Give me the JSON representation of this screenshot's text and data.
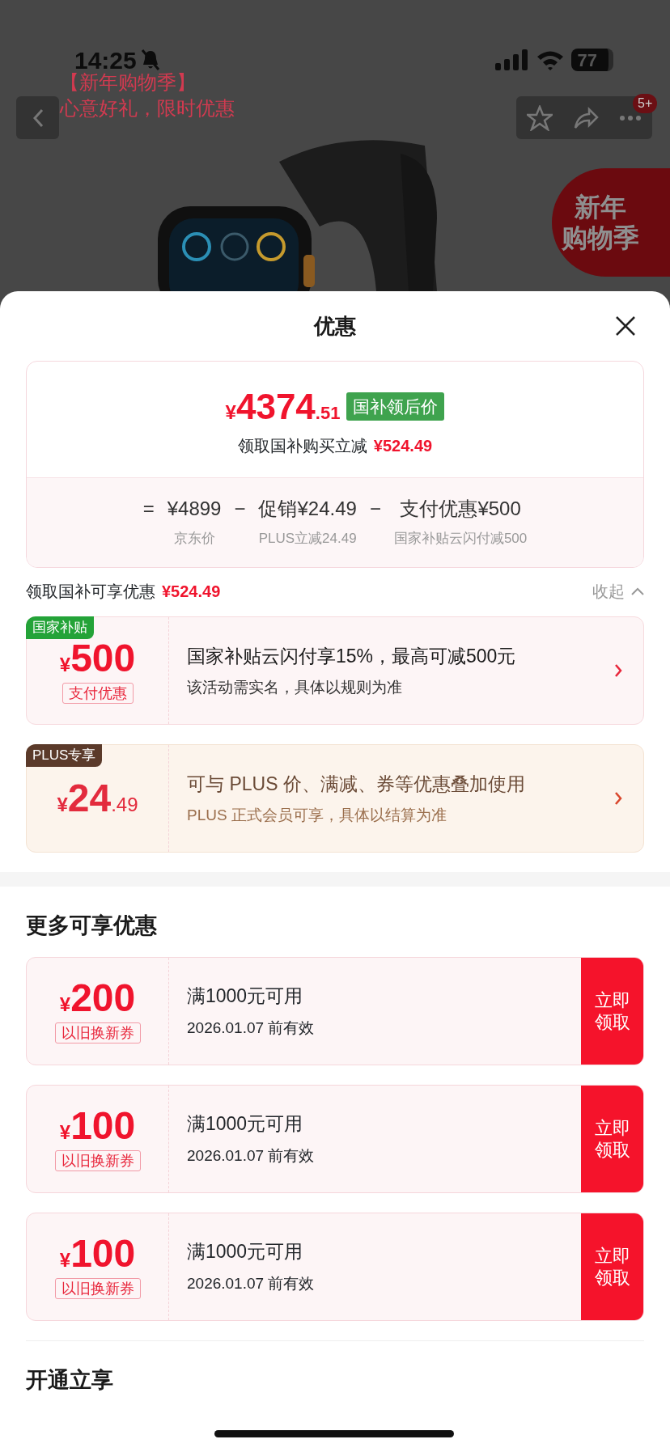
{
  "status_bar": {
    "time": "14:25",
    "battery": "77"
  },
  "background_page": {
    "promo_lines": [
      "【新年购物季】",
      "心意好礼，限时优惠"
    ],
    "message_badge": "5+",
    "banner_lines": [
      "新年",
      "购物季"
    ],
    "product": {
      "kind": "picture"
    }
  },
  "sheet": {
    "title": "优惠",
    "price_summary": {
      "currency": "¥",
      "integer": "4374",
      "decimal": ".51",
      "tag": "国补领后价",
      "saving_label": "领取国补购买立减",
      "saving_amount": "¥524.49",
      "breakdown": [
        {
          "operator": "=",
          "value": "¥4899",
          "caption": "京东价"
        },
        {
          "operator": "−",
          "value": "促销¥24.49",
          "caption": "PLUS立减24.49"
        },
        {
          "operator": "−",
          "value": "支付优惠¥500",
          "caption": "国家补贴云闪付减500"
        }
      ]
    },
    "subsidy_header": {
      "label": "领取国补可享优惠",
      "amount": "¥524.49",
      "toggle": "收起",
      "expanded": true
    },
    "offers": [
      {
        "kind": "subsidy",
        "tag": "国家补贴",
        "currency": "¥",
        "integer": "500",
        "type_label": "支付优惠",
        "title": "国家补贴云闪付享15%，最高可减500元",
        "subtitle": "该活动需实名，具体以规则为准"
      },
      {
        "kind": "plus",
        "tag": "PLUS专享",
        "currency": "¥",
        "integer": "24",
        "decimal": ".49",
        "title": "可与 PLUS 价、满减、券等优惠叠加使用",
        "subtitle": "PLUS 正式会员可享，具体以结算为准"
      }
    ],
    "more_title": "更多可享优惠",
    "coupons": [
      {
        "currency": "¥",
        "amount": "200",
        "type_label": "以旧换新券",
        "condition": "满1000元可用",
        "validity": "2026.01.07 前有效",
        "button": "立即领取"
      },
      {
        "currency": "¥",
        "amount": "100",
        "type_label": "以旧换新券",
        "condition": "满1000元可用",
        "validity": "2026.01.07 前有效",
        "button": "立即领取"
      },
      {
        "currency": "¥",
        "amount": "100",
        "type_label": "以旧换新券",
        "condition": "满1000元可用",
        "validity": "2026.01.07 前有效",
        "button": "立即领取"
      }
    ],
    "next_section_title": "开通立享"
  }
}
